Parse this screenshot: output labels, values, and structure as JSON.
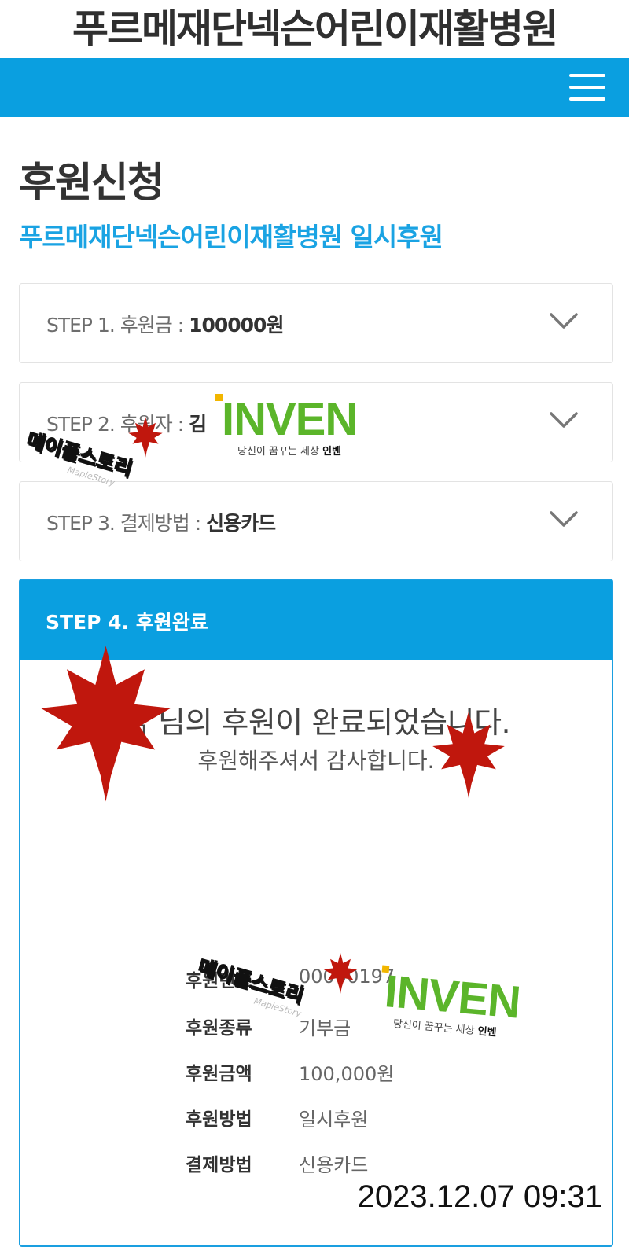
{
  "header": {
    "title": "푸르메재단넥슨어린이재활병원",
    "menu_icon": "hamburger-menu-icon",
    "accent": "#0a9fe0"
  },
  "page": {
    "heading": "후원신청",
    "subheading": "푸르메재단넥슨어린이재활병원 일시후원"
  },
  "steps": [
    {
      "label": "STEP 1. 후원금 : ",
      "value": "100000원"
    },
    {
      "label": "STEP 2. 후원자 : ",
      "value": "김"
    },
    {
      "label": "STEP 3. 결제방법 : ",
      "value": "신용카드"
    }
  ],
  "step4": {
    "title": "STEP 4. 후원완료",
    "message": "김 님의 후원이 완료되었습니다.",
    "thanks": "후원해주셔서 감사합니다.",
    "details": [
      {
        "label": "후원번호",
        "value": "00000197"
      },
      {
        "label": "후원종류",
        "value": "기부금"
      },
      {
        "label": "후원금액",
        "value": "100,000원"
      },
      {
        "label": "후원방법",
        "value": "일시후원"
      },
      {
        "label": "결제방법",
        "value": "신용카드"
      }
    ]
  },
  "timestamp": "2023.12.07 09:31",
  "watermarks": {
    "maple_text": "메이플스토리",
    "maple_sub": "MapleStory",
    "inven_text": "INVEN",
    "inven_tag_prefix": "당신이 꿈꾸는 세상 ",
    "inven_tag_brand": "인벤",
    "maple_leaf_color": "#c0170d"
  }
}
